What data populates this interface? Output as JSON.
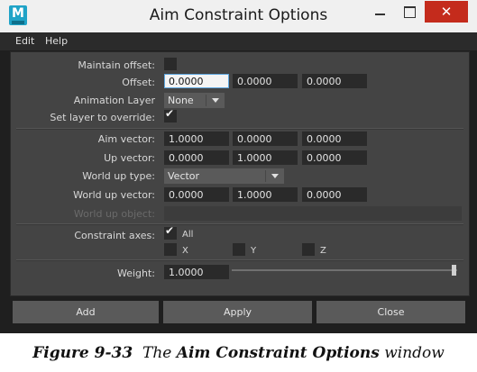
{
  "window": {
    "title": "Aim Constraint Options",
    "app_icon_letter": "M",
    "close_glyph": "✕"
  },
  "menubar": {
    "items": [
      "Edit",
      "Help"
    ]
  },
  "form": {
    "maintain_offset": {
      "label": "Maintain offset:",
      "checked": false
    },
    "offset": {
      "label": "Offset:",
      "values": [
        "0.0000",
        "0.0000",
        "0.0000"
      ]
    },
    "animation_layer": {
      "label": "Animation Layer",
      "value": "None"
    },
    "set_layer_override": {
      "label": "Set layer to override:",
      "checked": true
    },
    "aim_vector": {
      "label": "Aim vector:",
      "values": [
        "1.0000",
        "0.0000",
        "0.0000"
      ]
    },
    "up_vector": {
      "label": "Up vector:",
      "values": [
        "0.0000",
        "1.0000",
        "0.0000"
      ]
    },
    "world_up_type": {
      "label": "World up type:",
      "value": "Vector"
    },
    "world_up_vector": {
      "label": "World up vector:",
      "values": [
        "0.0000",
        "1.0000",
        "0.0000"
      ]
    },
    "world_up_object": {
      "label": "World up object:",
      "value": ""
    },
    "constraint_axes": {
      "label": "Constraint axes:",
      "all": {
        "label": "All",
        "checked": true
      },
      "x": {
        "label": "X",
        "checked": false
      },
      "y": {
        "label": "Y",
        "checked": false
      },
      "z": {
        "label": "Z",
        "checked": false
      }
    },
    "weight": {
      "label": "Weight:",
      "value": "1.0000",
      "slider_fraction": 1.0
    }
  },
  "buttons": {
    "add": "Add",
    "apply": "Apply",
    "close": "Close"
  },
  "caption": {
    "figure": "Figure 9-33",
    "pre": "The",
    "bold": "Aim Constraint Options",
    "post": "window"
  },
  "colors": {
    "close_button": "#c42b1c",
    "panel": "#444444",
    "field": "#2a2a2a",
    "focus_border": "#5fa8e0"
  },
  "icons": [
    "maya-app-icon",
    "minimize-icon",
    "maximize-icon",
    "close-icon",
    "checkmark-icon",
    "dropdown-arrow-icon"
  ]
}
